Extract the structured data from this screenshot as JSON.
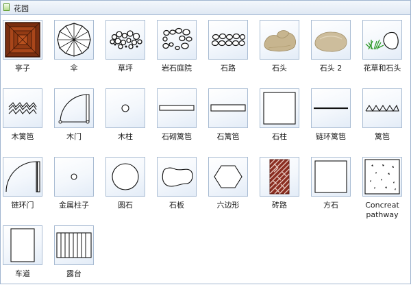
{
  "panel": {
    "title": "花园",
    "title_icon": "green-panel-icon"
  },
  "items": [
    {
      "label": "亭子",
      "icon": "gazebo-icon"
    },
    {
      "label": "伞",
      "icon": "umbrella-icon"
    },
    {
      "label": "草坪",
      "icon": "lawn-icon"
    },
    {
      "label": "岩石庭院",
      "icon": "rock-garden-icon"
    },
    {
      "label": "石路",
      "icon": "stone-path-icon"
    },
    {
      "label": "石头",
      "icon": "rock-icon"
    },
    {
      "label": "石头 2",
      "icon": "rock-2-icon"
    },
    {
      "label": "花草和石头",
      "icon": "plants-and-rock-icon"
    },
    {
      "label": "木篱笆",
      "icon": "wood-fence-icon"
    },
    {
      "label": "木门",
      "icon": "wood-gate-icon"
    },
    {
      "label": "木柱",
      "icon": "wood-post-icon"
    },
    {
      "label": "石砌篱笆",
      "icon": "stone-fence-icon"
    },
    {
      "label": "石篱笆",
      "icon": "stone-wall-icon"
    },
    {
      "label": "石柱",
      "icon": "stone-pillar-icon"
    },
    {
      "label": "链环篱笆",
      "icon": "chain-link-fence-icon"
    },
    {
      "label": "篱笆",
      "icon": "fence-icon"
    },
    {
      "label": "链环门",
      "icon": "chain-link-gate-icon"
    },
    {
      "label": "金属柱子",
      "icon": "metal-post-icon"
    },
    {
      "label": "圆石",
      "icon": "round-stone-icon"
    },
    {
      "label": "石板",
      "icon": "flagstone-icon"
    },
    {
      "label": "六边形",
      "icon": "hexagon-icon"
    },
    {
      "label": "砖路",
      "icon": "brick-path-icon"
    },
    {
      "label": "方石",
      "icon": "square-stone-icon"
    },
    {
      "label": "Concreat pathway",
      "icon": "concrete-pathway-icon"
    },
    {
      "label": "车道",
      "icon": "driveway-icon"
    },
    {
      "label": "露台",
      "icon": "deck-icon"
    }
  ]
}
